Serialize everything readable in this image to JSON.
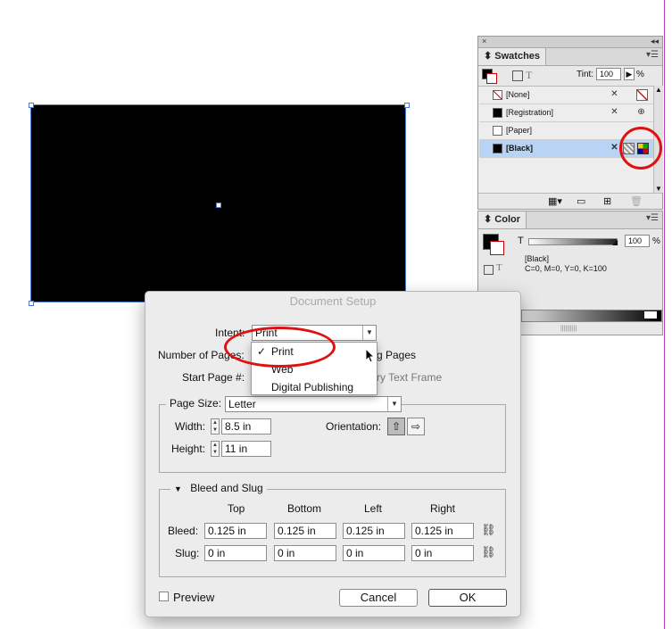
{
  "swatches_panel": {
    "tab_label": "Swatches",
    "tint_label": "Tint:",
    "tint_value": "100",
    "percent": "%",
    "text_toggle": "T",
    "items": [
      {
        "name": "[None]",
        "chip": "none"
      },
      {
        "name": "[Registration]",
        "chip": "#000000"
      },
      {
        "name": "[Paper]",
        "chip": "#ffffff"
      },
      {
        "name": "[Black]",
        "chip": "#000000"
      }
    ],
    "selected_item": "[Black]"
  },
  "color_panel": {
    "tab_label": "Color",
    "tint_letter": "T",
    "tint_value": "100",
    "percent": "%",
    "swatch_name": "[Black]",
    "values": "C=0, M=0, Y=0, K=100",
    "text_toggle": "T"
  },
  "dialog": {
    "title": "Document Setup",
    "intent_label": "Intent:",
    "intent_value": "Print",
    "intent_options": [
      "Print",
      "Web",
      "Digital Publishing"
    ],
    "pages_label": "Number of Pages:",
    "facing_pages_partial": "g Pages",
    "start_page_label": "Start Page #:",
    "text_frame_partial": "ry Text Frame",
    "page_size_label": "Page Size:",
    "page_size_value": "Letter",
    "width_label": "Width:",
    "width_value": "8.5 in",
    "height_label": "Height:",
    "height_value": "11 in",
    "orientation_label": "Orientation:",
    "bleed_section_label": "Bleed and Slug",
    "col_top": "Top",
    "col_bottom": "Bottom",
    "col_left": "Left",
    "col_right": "Right",
    "bleed_label": "Bleed:",
    "bleed_values": [
      "0.125 in",
      "0.125 in",
      "0.125 in",
      "0.125 in"
    ],
    "slug_label": "Slug:",
    "slug_values": [
      "0 in",
      "0 in",
      "0 in",
      "0 in"
    ],
    "preview_label": "Preview",
    "cancel_label": "Cancel",
    "ok_label": "OK"
  },
  "colors": {
    "annotation_red": "#e01010",
    "selection_blue": "#b8d4f5",
    "guide_magenta": "#c03ac0"
  }
}
